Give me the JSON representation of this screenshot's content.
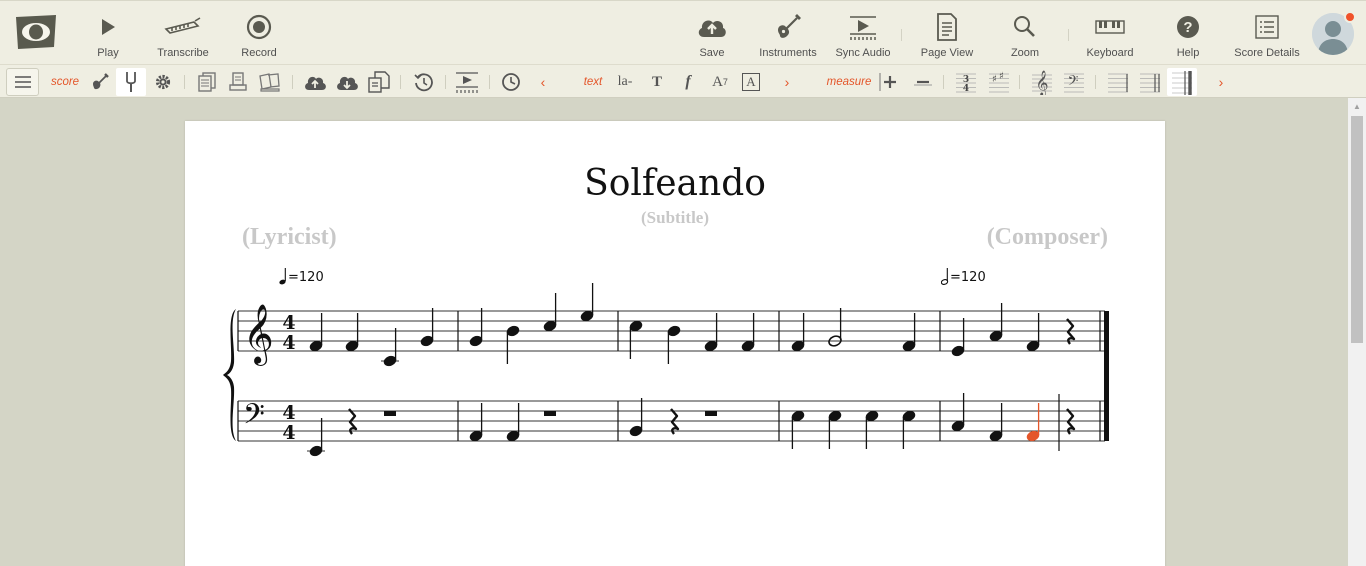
{
  "toolbar": {
    "play": "Play",
    "transcribe": "Transcribe",
    "record": "Record",
    "save": "Save",
    "instruments": "Instruments",
    "sync_audio": "Sync Audio",
    "page_view": "Page View",
    "zoom": "Zoom",
    "keyboard": "Keyboard",
    "help": "Help",
    "score_details": "Score Details"
  },
  "subtoolbar": {
    "score_label": "score",
    "text_label": "text",
    "measure_label": "measure",
    "lyrics_glyph": "la-",
    "text_glyph": "T",
    "dynamics_glyph": "f",
    "superscript_glyph": "A",
    "boxed_glyph": "A",
    "time_sig_top": "3",
    "time_sig_bottom": "4",
    "prev_arrow": "‹",
    "next_arrow": "›"
  },
  "score": {
    "title": "Solfeando",
    "subtitle": "(Subtitle)",
    "lyricist": "(Lyricist)",
    "composer": "(Composer)",
    "tempo_1_value": "120",
    "tempo_2_value": "120",
    "time_signature": {
      "numerator": "4",
      "denominator": "4"
    },
    "selected_note_color": "#e4562a"
  },
  "colors": {
    "accent": "#e4562a",
    "toolbar_bg": "#efeee2",
    "workspace_bg": "#d4d5c6"
  },
  "icons": [
    "logo-eye-icon",
    "play-icon",
    "piano-roll-icon",
    "record-icon",
    "cloud-upload-icon",
    "guitar-icon",
    "sync-audio-icon",
    "page-icon",
    "search-icon",
    "keyboard-icon",
    "help-icon",
    "list-icon",
    "avatar"
  ]
}
